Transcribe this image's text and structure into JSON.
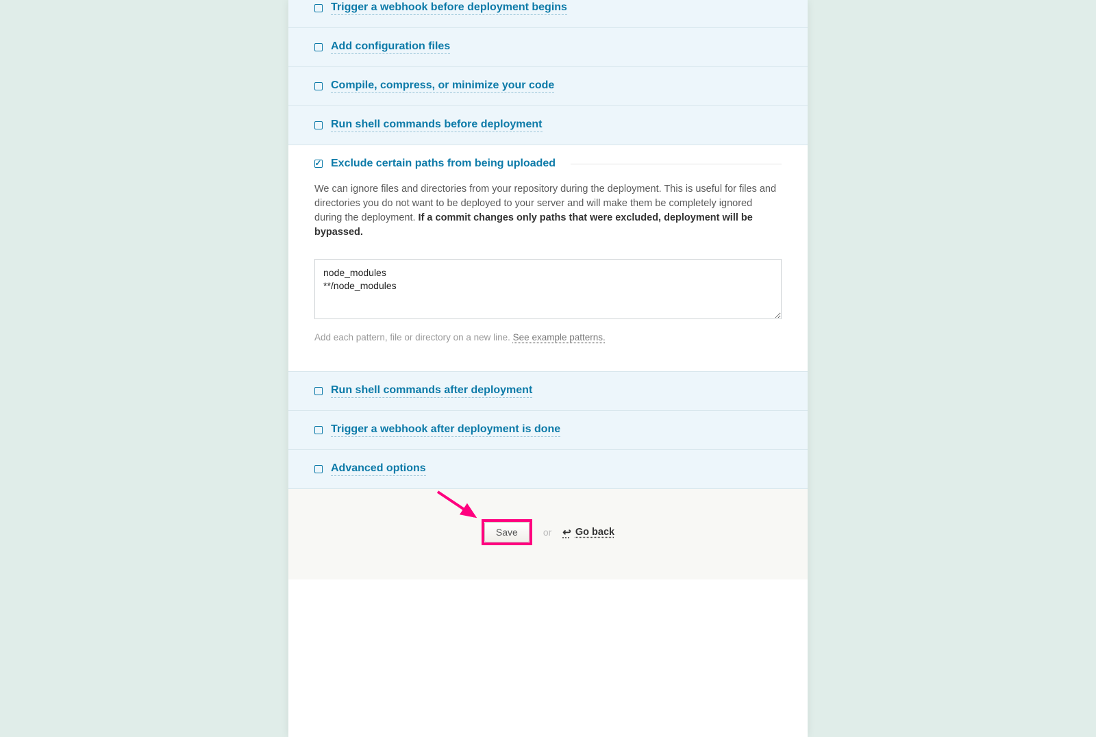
{
  "sections": {
    "webhook_before": {
      "title": "Trigger a webhook before deployment begins",
      "checked": false
    },
    "config_files": {
      "title": "Add configuration files",
      "checked": false
    },
    "compile": {
      "title": "Compile, compress, or minimize your code",
      "checked": false
    },
    "shell_before": {
      "title": "Run shell commands before deployment",
      "checked": false
    },
    "exclude_paths": {
      "title": "Exclude certain paths from being uploaded",
      "checked": true,
      "description_part1": "We can ignore files and directories from your repository during the deployment. This is useful for files and directories you do not want to be deployed to your server and will make them be completely ignored during the deployment. ",
      "description_bold": "If a commit changes only paths that were excluded, deployment will be bypassed.",
      "textarea_value": "node_modules\n**/node_modules",
      "helper_text": "Add each pattern, file or directory on a new line. ",
      "helper_link": "See example patterns."
    },
    "shell_after": {
      "title": "Run shell commands after deployment",
      "checked": false
    },
    "webhook_after": {
      "title": "Trigger a webhook after deployment is done",
      "checked": false
    },
    "advanced": {
      "title": "Advanced options",
      "checked": false
    }
  },
  "footer": {
    "save_label": "Save",
    "or_label": "or",
    "go_back_label": "Go back"
  }
}
